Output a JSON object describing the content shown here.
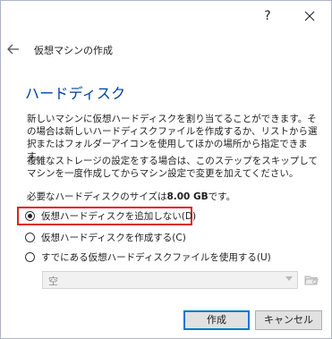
{
  "titlebar": {
    "help_label": "?"
  },
  "wizard": {
    "title": "仮想マシンの作成"
  },
  "page": {
    "heading": "ハードディスク",
    "paragraph1": "新しいマシンに仮想ハードディスクを割り当てることができます。その場合は新しいハードディスクファイルを作成するか、リストから選択またはフォルダーアイコンを使用してほかの場所から指定できます。",
    "paragraph2": "複雑なストレージの設定をする場合は、このステップをスキップしてマシンを一度作成してからマシン設定で変更を加えてください。",
    "size_prefix": "必要なハードディスクのサイズは",
    "size_value": "8.00 GB",
    "size_suffix": "です。"
  },
  "options": [
    {
      "label": "仮想ハードディスクを追加しない(D)",
      "checked": true
    },
    {
      "label": "仮想ハードディスクを作成する(C)",
      "checked": false
    },
    {
      "label": "すでにある仮想ハードディスクファイルを使用する(U)",
      "checked": false
    }
  ],
  "file_select": {
    "value": "空",
    "enabled": false
  },
  "buttons": {
    "create": "作成",
    "cancel": "キャンセル"
  },
  "colors": {
    "heading": "#003f9c",
    "highlight": "#e02020",
    "default_button_border": "#0078d7"
  }
}
